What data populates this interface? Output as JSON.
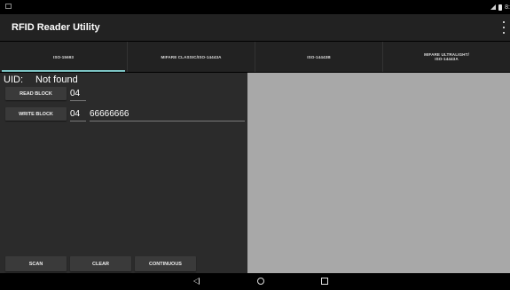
{
  "app": {
    "title": "RFID Reader Utility"
  },
  "status": {
    "time": "8:"
  },
  "tabs": [
    {
      "label": "ISO-15693"
    },
    {
      "label": "MIFARE CLASSIC/ISO-14443A"
    },
    {
      "label": "ISO-14443B"
    },
    {
      "label": "MIFARE ULTRALIGHT/\nISO-14443A"
    }
  ],
  "main": {
    "uid_label": "UID:",
    "uid_value": "Not found",
    "read_block_label": "READ BLOCK",
    "read_block_value": "04",
    "write_block_label": "WRITE BLOCK",
    "write_block_value": "04",
    "write_data_value": "66666666"
  },
  "actions": {
    "scan": "SCAN",
    "clear": "CLEAR",
    "continuous": "CONTINUOUS"
  },
  "colors": {
    "accent": "#7cc4c4",
    "panel": "#a8a8a8",
    "background": "#2b2b2b"
  }
}
